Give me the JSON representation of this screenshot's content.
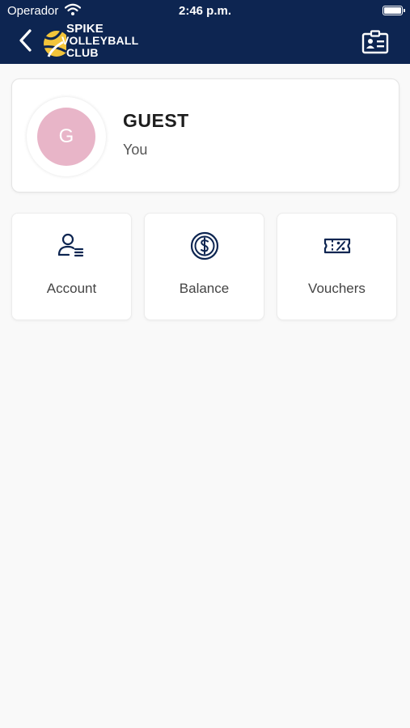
{
  "status_bar": {
    "carrier": "Operador",
    "time": "2:46 p.m."
  },
  "header": {
    "logo_lines": [
      "SPIKE",
      "VOLLEYBALL",
      "CLUB"
    ],
    "back_icon": "chevron-left-icon",
    "right_icon": "id-card-icon",
    "background_color": "#0d2551"
  },
  "profile": {
    "avatar_initial": "G",
    "avatar_color": "#e8b5c8",
    "name": "GUEST",
    "role": "You"
  },
  "menu": {
    "items": [
      {
        "label": "Account",
        "icon": "user-list-icon"
      },
      {
        "label": "Balance",
        "icon": "dollar-coin-icon"
      },
      {
        "label": "Vouchers",
        "icon": "ticket-percent-icon"
      }
    ],
    "icon_color": "#0d2551"
  }
}
